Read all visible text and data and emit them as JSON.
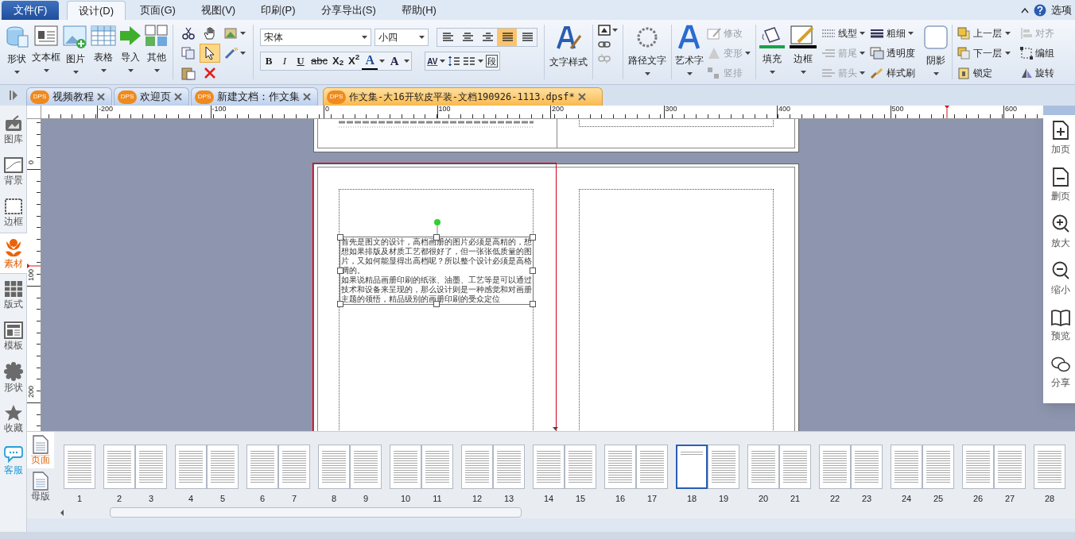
{
  "file_menu": "文件(F)",
  "menu_tabs": [
    {
      "label": "设计(D)",
      "selected": true
    },
    {
      "label": "页面(G)",
      "selected": false
    },
    {
      "label": "视图(V)",
      "selected": false
    },
    {
      "label": "印刷(P)",
      "selected": false
    },
    {
      "label": "分享导出(S)",
      "selected": false
    },
    {
      "label": "帮助(H)",
      "selected": false
    }
  ],
  "options_label": "选项",
  "insert_buttons": [
    "形状",
    "文本框",
    "图片",
    "表格",
    "导入",
    "其他"
  ],
  "edit_tools": [
    {
      "selected": false
    },
    {
      "selected": false
    },
    {
      "selected": false
    },
    {
      "selected": false
    },
    {
      "selected": true
    },
    {
      "selected": false
    },
    {
      "selected": false
    },
    {
      "selected": false
    }
  ],
  "font": {
    "family": "宋体",
    "size": "小四"
  },
  "align_buttons": [
    {
      "selected": false
    },
    {
      "selected": false
    },
    {
      "selected": false
    },
    {
      "selected": true
    },
    {
      "selected": false
    }
  ],
  "format_buttons": [
    "B",
    "I",
    "U",
    "abc",
    "X$_{2}$",
    "X$^{2}$",
    "A",
    "A"
  ],
  "paragraph_buttons": [
    "AV",
    "段"
  ],
  "text_style": "文字样式",
  "path_text": "路径文字",
  "art_text": "艺术字",
  "art_options": [
    {
      "label": "修改",
      "disabled": true
    },
    {
      "label": "变形",
      "disabled": true
    },
    {
      "label": "竖排",
      "disabled": true
    }
  ],
  "fill": {
    "label": "填充",
    "color": "#16a34a"
  },
  "border": {
    "label": "边框",
    "color": "#000000"
  },
  "line_options": [
    {
      "label": "线型",
      "disabled": false
    },
    {
      "label": "箭尾",
      "disabled": true
    },
    {
      "label": "箭头",
      "disabled": true
    }
  ],
  "line_style": [
    "粗细",
    "透明度",
    "样式刷"
  ],
  "shadow": "阴影",
  "layer_options": [
    {
      "label": "上一层",
      "disabled": false
    },
    {
      "label": "下一层",
      "disabled": false
    },
    {
      "label": "锁定",
      "disabled": false
    }
  ],
  "arrange_options": [
    {
      "label": "对齐",
      "disabled": true
    },
    {
      "label": "编组",
      "disabled": false
    },
    {
      "label": "旋转",
      "disabled": false
    }
  ],
  "doc_tabs": [
    {
      "badge": "DPS",
      "label": "视频教程",
      "selected": false
    },
    {
      "badge": "DPS",
      "label": "欢迎页",
      "selected": false
    },
    {
      "badge": "DPS",
      "label": "新建文档：作文集",
      "selected": false
    },
    {
      "badge": "DPS",
      "label": "作文集-大16开软皮平装-文档190926-1113.dpsf*",
      "selected": true
    }
  ],
  "sidebar": [
    {
      "label": "图库",
      "kind": "tool",
      "selected": false
    },
    {
      "label": "背景",
      "kind": "tool",
      "selected": false
    },
    {
      "label": "边框",
      "kind": "tool",
      "selected": false
    },
    {
      "label": "素材",
      "kind": "tool",
      "selected": true
    },
    {
      "label": "版式",
      "kind": "tool",
      "selected": false
    },
    {
      "label": "模板",
      "kind": "tool",
      "selected": false
    },
    {
      "label": "形状",
      "kind": "tool",
      "selected": false
    },
    {
      "label": "收藏",
      "kind": "tool",
      "selected": false
    },
    {
      "label": "客服",
      "kind": "service",
      "selected": false
    }
  ],
  "ruler_h": [
    "-200",
    "-100",
    "0",
    "100",
    "200",
    "300",
    "400",
    "500",
    "600"
  ],
  "ruler_v": [
    "0",
    "100",
    "200"
  ],
  "text_box": [
    "首先是图文的设计，高档画册的图片必须是高精的，想想如果排版及材质工艺都很好了，但一张张低质量的图片，又如何能显得出高档呢？所以整个设计必须是高格调的。",
    "如果说精品画册印刷的纸张、油墨、工艺等是可以通过技术和设备来呈现的，那么设计则是一种感觉和对画册主题的领悟，精品级别的画册印刷的受众定位"
  ],
  "right_panel": [
    "加页",
    "删页",
    "放大",
    "缩小",
    "预览",
    "分享"
  ],
  "page_tabs": [
    {
      "label": "页面",
      "selected": true
    },
    {
      "label": "母版",
      "selected": false
    }
  ],
  "thumbnails": [
    {
      "label": "1",
      "selected": false
    },
    {
      "label": "2",
      "selected": false
    },
    {
      "label": "3",
      "selected": false
    },
    {
      "label": "4",
      "selected": false
    },
    {
      "label": "5",
      "selected": false
    },
    {
      "label": "6",
      "selected": false
    },
    {
      "label": "7",
      "selected": false
    },
    {
      "label": "8",
      "selected": false
    },
    {
      "label": "9",
      "selected": false
    },
    {
      "label": "10",
      "selected": false
    },
    {
      "label": "11",
      "selected": false
    },
    {
      "label": "12",
      "selected": false
    },
    {
      "label": "13",
      "selected": false
    },
    {
      "label": "14",
      "selected": false
    },
    {
      "label": "15",
      "selected": false
    },
    {
      "label": "16",
      "selected": false
    },
    {
      "label": "17",
      "selected": false
    },
    {
      "label": "18",
      "selected": true
    },
    {
      "label": "19",
      "selected": false
    },
    {
      "label": "20",
      "selected": false
    },
    {
      "label": "21",
      "selected": false
    },
    {
      "label": "22",
      "selected": false
    },
    {
      "label": "23",
      "selected": false
    },
    {
      "label": "24",
      "selected": false
    },
    {
      "label": "25",
      "selected": false
    },
    {
      "label": "26",
      "selected": false
    },
    {
      "label": "27",
      "selected": false
    },
    {
      "label": "28",
      "selected": false
    }
  ]
}
